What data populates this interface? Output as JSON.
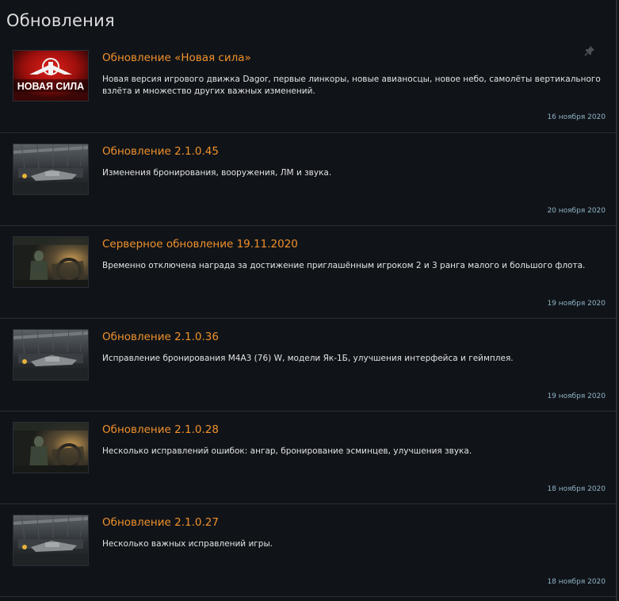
{
  "page": {
    "title": "Обновления"
  },
  "items": [
    {
      "title": "Обновление «Новая сила»",
      "desc": "Новая версия игрового движка Dagor, первые линкоры, новые авианосцы, новое небо, самолёты вертикального взлёта и множество других важных изменений.",
      "date": "16 ноября 2020",
      "thumb_text": "НОВАЯ СИЛА",
      "pinned": true
    },
    {
      "title": "Обновление 2.1.0.45",
      "desc": "Изменения бронирования, вооружения, ЛМ и звука.",
      "date": "20 ноября 2020"
    },
    {
      "title": "Серверное обновление 19.11.2020",
      "desc": "Временно отключена награда за достижение приглашённым игроком 2 и 3 ранга малого и большого флота.",
      "date": "19 ноября 2020"
    },
    {
      "title": "Обновление 2.1.0.36",
      "desc": "Исправление бронирования M4A3 (76) W, модели Як-1Б, улучшения интерфейса и геймплея.",
      "date": "19 ноября 2020"
    },
    {
      "title": "Обновление 2.1.0.28",
      "desc": "Несколько исправлений ошибок: ангар, бронирование эсминцев, улучшения звука.",
      "date": "18 ноября 2020"
    },
    {
      "title": "Обновление 2.1.0.27",
      "desc": "Несколько важных исправлений игры.",
      "date": "18 ноября 2020"
    }
  ],
  "colors": {
    "background": "#101419",
    "title_accent": "#f0902a",
    "date": "#8fb2c4",
    "divider": "#2b2f34"
  },
  "icons": {
    "pin": "pin-icon"
  }
}
